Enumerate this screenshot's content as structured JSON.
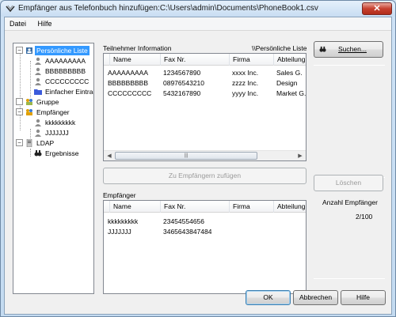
{
  "window": {
    "title": "Empfänger aus Telefonbuch hinzufügen:C:\\Users\\admin\\Documents\\PhoneBook1.csv",
    "close_glyph": "✕"
  },
  "menu": {
    "items": [
      "Datei",
      "Hilfe"
    ]
  },
  "tree": {
    "persoenliche_liste": "Persönliche Liste",
    "contacts": [
      "AAAAAAAAA",
      "BBBBBBBBB",
      "CCCCCCCCC"
    ],
    "einfacher_eintrag": "Einfacher Eintrag",
    "gruppe": "Gruppe",
    "empfaenger": "Empfänger",
    "recipients": [
      "kkkkkkkkk",
      "JJJJJJJ"
    ],
    "ldap": "LDAP",
    "ergebnisse": "Ergebnisse",
    "collapse_glyph": "−"
  },
  "participants": {
    "label": "Teilnehmer Information",
    "path": "\\\\Persönliche Liste",
    "columns": [
      "Name",
      "Fax Nr.",
      "Firma",
      "Abteilung"
    ],
    "rows": [
      [
        "AAAAAAAAA",
        "1234567890",
        "xxxx Inc.",
        "Sales G."
      ],
      [
        "BBBBBBBBB",
        "08976543210",
        "zzzz Inc.",
        "Design"
      ],
      [
        "CCCCCCCCC",
        "5432167890",
        "yyyy Inc.",
        "Market G."
      ]
    ]
  },
  "add_button": "Zu Empfängern zufügen",
  "recipients": {
    "label": "Empfänger",
    "columns": [
      "Name",
      "Fax Nr.",
      "Firma",
      "Abteilung"
    ],
    "rows": [
      [
        "kkkkkkkkk",
        "23454554656",
        "",
        ""
      ],
      [
        "JJJJJJJ",
        "3465643847484",
        "",
        ""
      ]
    ]
  },
  "search_button": "Suchen...",
  "delete_button": "Löschen",
  "count_label": "Anzahl Empfänger",
  "count_value": "2/100",
  "ok_button": "OK",
  "cancel_button": "Abbrechen",
  "help_button": "Hilfe",
  "scroll_glyphs": {
    "left": "◀",
    "right": "▶",
    "grip": "|||"
  }
}
